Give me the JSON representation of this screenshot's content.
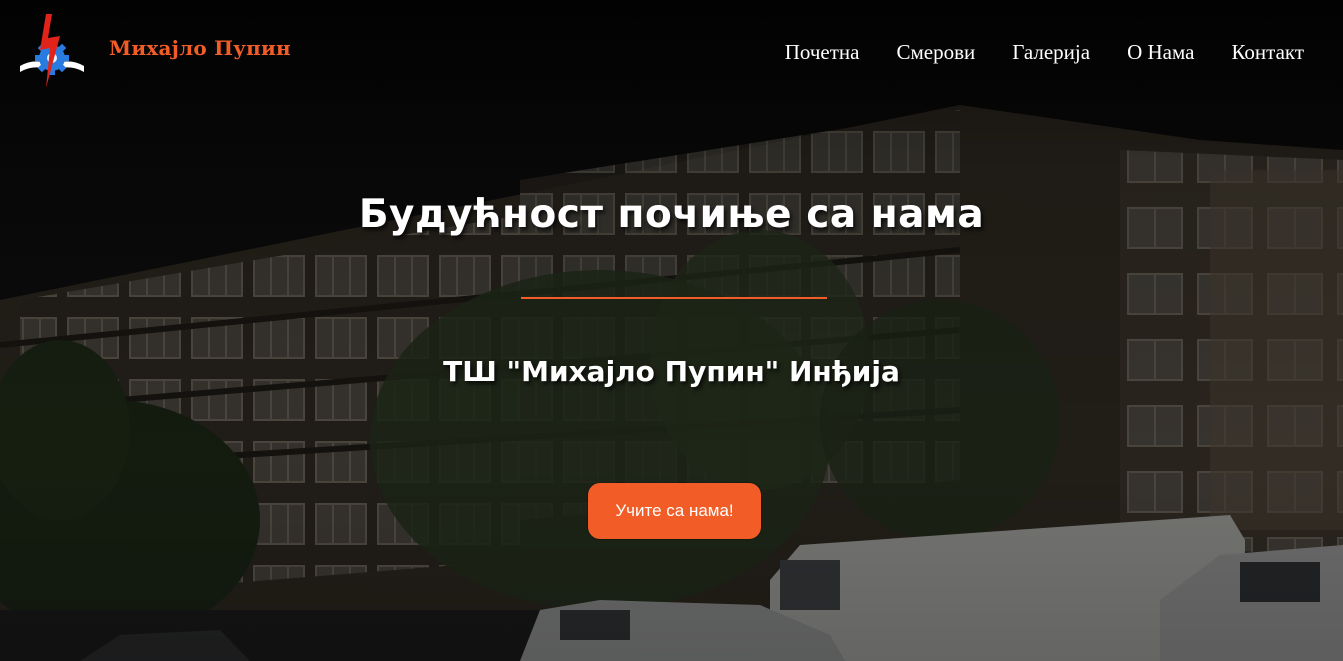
{
  "brand": {
    "name": "Михајло Пупин",
    "logo_icon": "school-lightning-gear-logo-icon"
  },
  "nav": {
    "items": [
      {
        "label": "Почетна"
      },
      {
        "label": "Смерови"
      },
      {
        "label": "Галерија"
      },
      {
        "label": "О Нама"
      },
      {
        "label": "Контакт"
      }
    ]
  },
  "hero": {
    "title": "Будућност почиње са нама",
    "subtitle": "ТШ \"Михајло Пупин\" Инђија",
    "cta_label": "Учите са нама!"
  },
  "colors": {
    "accent": "#f25c27",
    "text": "#ffffff",
    "nav_background": "#000000"
  }
}
